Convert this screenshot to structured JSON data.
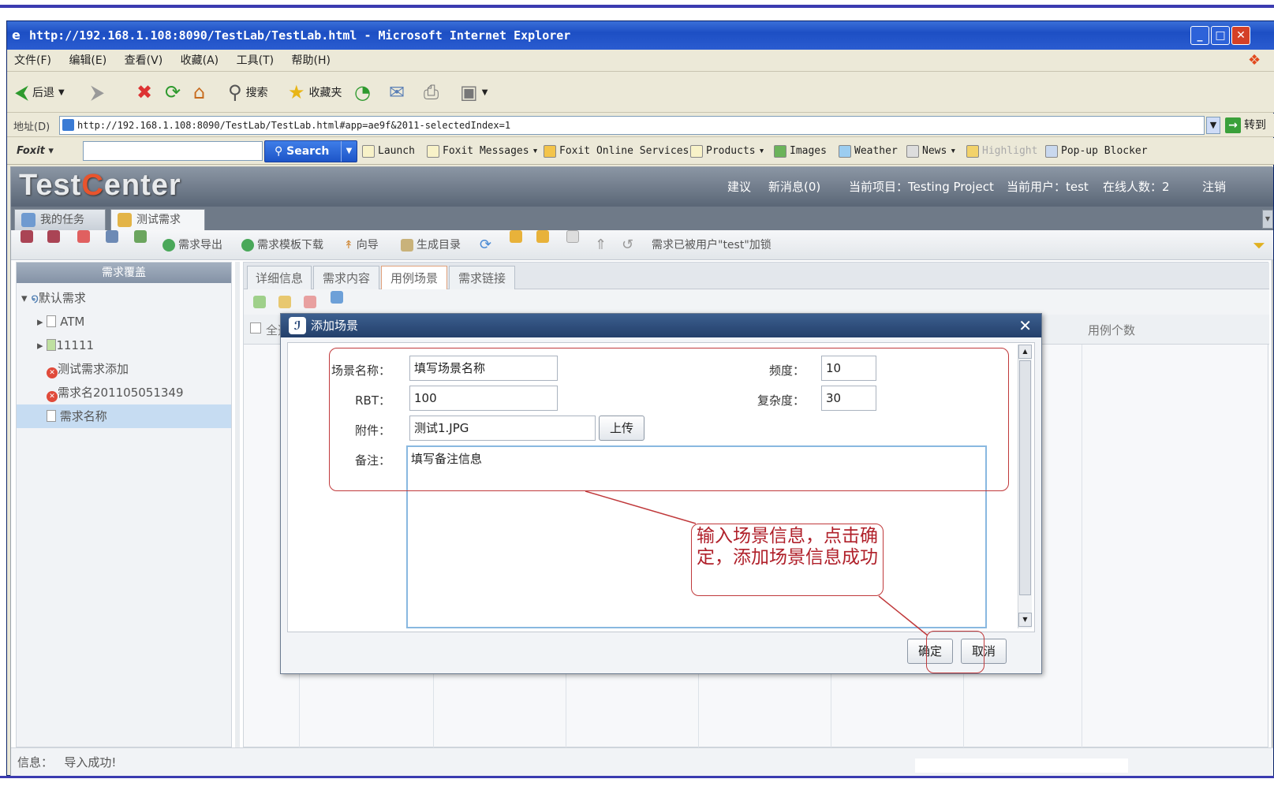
{
  "browser": {
    "title": "http://192.168.1.108:8090/TestLab/TestLab.html - Microsoft Internet Explorer",
    "menu": [
      "文件(F)",
      "编辑(E)",
      "查看(V)",
      "收藏(A)",
      "工具(T)",
      "帮助(H)"
    ],
    "toolbar": {
      "back": "后退",
      "search": "搜索",
      "favorites": "收藏夹"
    },
    "address_label": "地址(D)",
    "address": "http://192.168.1.108:8090/TestLab/TestLab.html#app=ae9f&2011-selectedIndex=1",
    "go": "转到",
    "foxit": {
      "logo": "Foxit",
      "search": "Search",
      "items": [
        "Launch",
        "Foxit Messages",
        "Foxit Online Services",
        "Products",
        "Images",
        "Weather",
        "News",
        "Highlight",
        "Pop-up Blocker"
      ]
    }
  },
  "app": {
    "brand_a": "Test",
    "brand_b": "C",
    "brand_c": "enter",
    "header": {
      "suggest": "建议",
      "messages": "新消息(0)",
      "project": "当前项目：Testing Project",
      "user": "当前用户：test",
      "online": "在线人数：2",
      "logout": "注销"
    },
    "tabs": [
      "我的任务",
      "测试需求"
    ],
    "toolbar": {
      "export": "需求导出",
      "template": "需求模板下载",
      "wizard": "向导",
      "gen_dir": "生成目录",
      "lock_msg": "需求已被用户\"test\"加锁"
    },
    "sidebar": {
      "title": "需求覆盖",
      "tree": [
        "默认需求",
        "ATM",
        "11111",
        "测试需求添加",
        "需求名201105051349",
        "需求名称"
      ]
    },
    "subtabs": [
      "详细信息",
      "需求内容",
      "用例场景",
      "需求链接"
    ],
    "grid": {
      "select_all": "全选",
      "case_count": "用例个数"
    },
    "status": {
      "label": "信息：",
      "value": "导入成功!"
    }
  },
  "dialog": {
    "title": "添加场景",
    "fields": {
      "scene_name_label": "场景名称：",
      "scene_name_value": "填写场景名称",
      "frequency_label": "频度：",
      "frequency_value": "10",
      "rbt_label": "RBT：",
      "rbt_value": "100",
      "complexity_label": "复杂度：",
      "complexity_value": "30",
      "attachment_label": "附件：",
      "attachment_value": "测试1.JPG",
      "upload": "上传",
      "remark_label": "备注：",
      "remark_value": "填写备注信息"
    },
    "confirm": "确定",
    "cancel": "取消"
  },
  "annotation": {
    "text": "输入场景信息，点击确定，添加场景信息成功"
  },
  "colors": {
    "annotation": "#c0393b",
    "titlebar": "#1d4fc4",
    "app_header": "#5a6676"
  }
}
